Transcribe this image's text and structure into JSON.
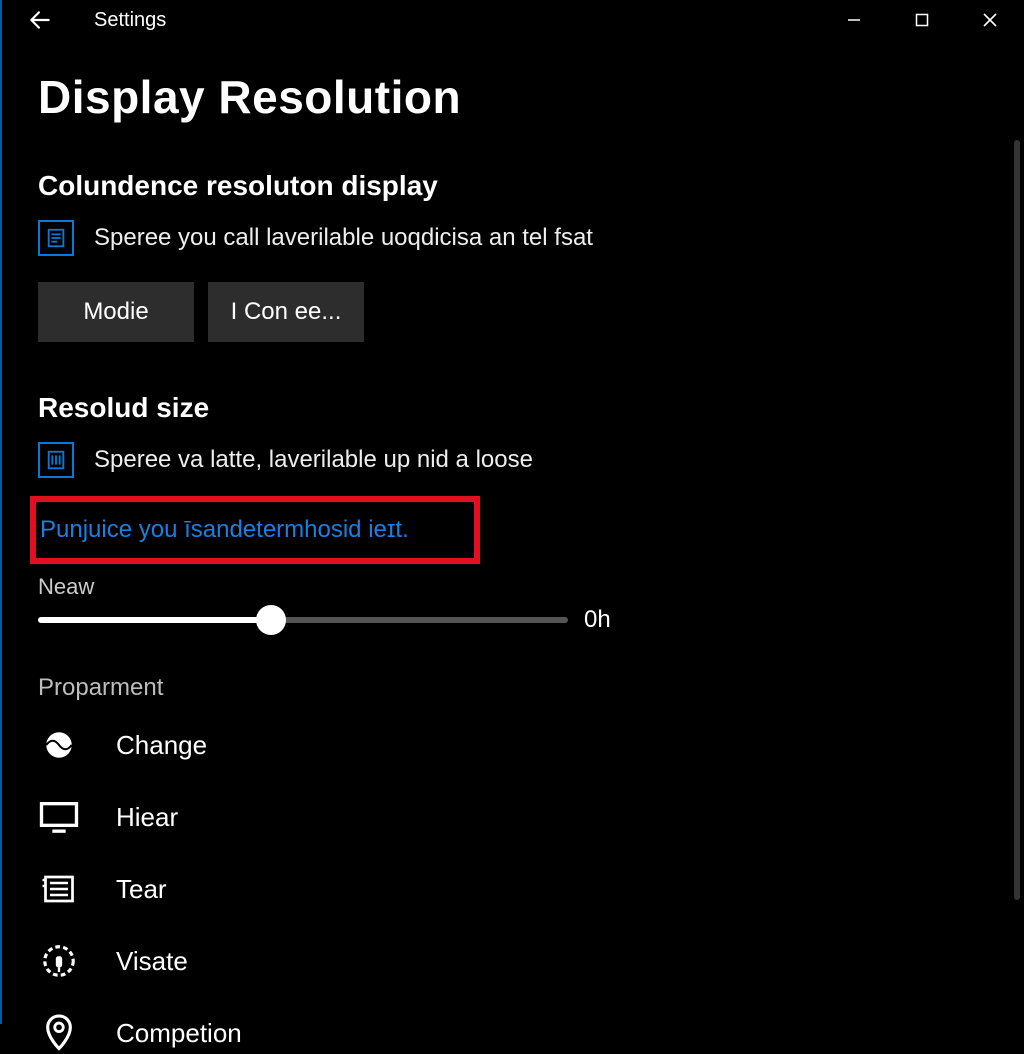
{
  "titlebar": {
    "app_title": "Settings"
  },
  "page": {
    "heading": "Display Resolution"
  },
  "section1": {
    "heading": "Colundence resoluton display",
    "info_text": "Speree you call laverilable uoqdicisa an tel fsat",
    "buttons": {
      "modie": "Modie",
      "iconee": "I Con ee..."
    }
  },
  "section2": {
    "heading": "Resolud size",
    "info_text": "Speree va latte, laverilable up nid a loose",
    "highlight_link": "Punjuice you īsandetermhosid ieɪt."
  },
  "slider": {
    "label": "Neaw",
    "value_text": "0h"
  },
  "proparment": {
    "heading": "Proparment",
    "items": [
      {
        "label": "Change"
      },
      {
        "label": "Hiear"
      },
      {
        "label": "Tear"
      },
      {
        "label": "Visate"
      },
      {
        "label": "Competion"
      }
    ]
  }
}
